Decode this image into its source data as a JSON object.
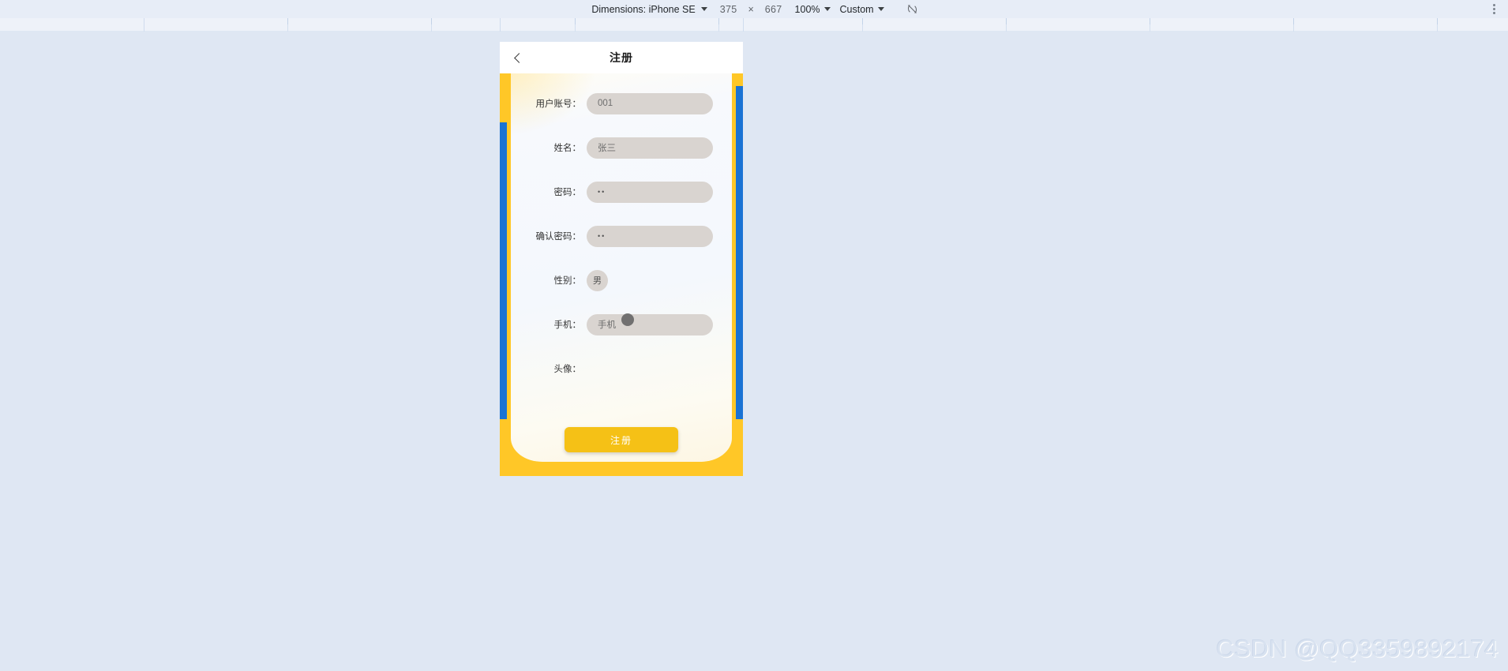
{
  "devtools": {
    "dimensions_label": "Dimensions: iPhone SE",
    "width_value": "375",
    "times_symbol": "×",
    "height_value": "667",
    "zoom_value": "100%",
    "throttling_value": "Custom",
    "rotate_icon": "rotate-device-icon",
    "menu_icon": "more-vertical-icon"
  },
  "phone": {
    "back_icon": "chevron-left-icon",
    "title": "注册",
    "form": {
      "rows": [
        {
          "label": "用户账号：",
          "value": "001",
          "type": "text"
        },
        {
          "label": "姓名：",
          "value": "张三",
          "type": "text"
        },
        {
          "label": "密码：",
          "value": "••",
          "type": "password"
        },
        {
          "label": "确认密码：",
          "value": "••",
          "type": "password"
        },
        {
          "label": "性别：",
          "value": "男",
          "type": "chip"
        },
        {
          "label": "手机：",
          "value": "手机",
          "type": "text"
        },
        {
          "label": "头像：",
          "value": "",
          "type": "empty"
        }
      ]
    },
    "submit_label": "注册"
  },
  "colors": {
    "page_background": "#dfe7f3",
    "accent_yellow": "#ffc727",
    "accent_blue": "#1a73d4",
    "button_yellow": "#f5c116",
    "field_grey": "#d9d4d0"
  },
  "watermark": {
    "text": "CSDN @QQ3359892174"
  }
}
